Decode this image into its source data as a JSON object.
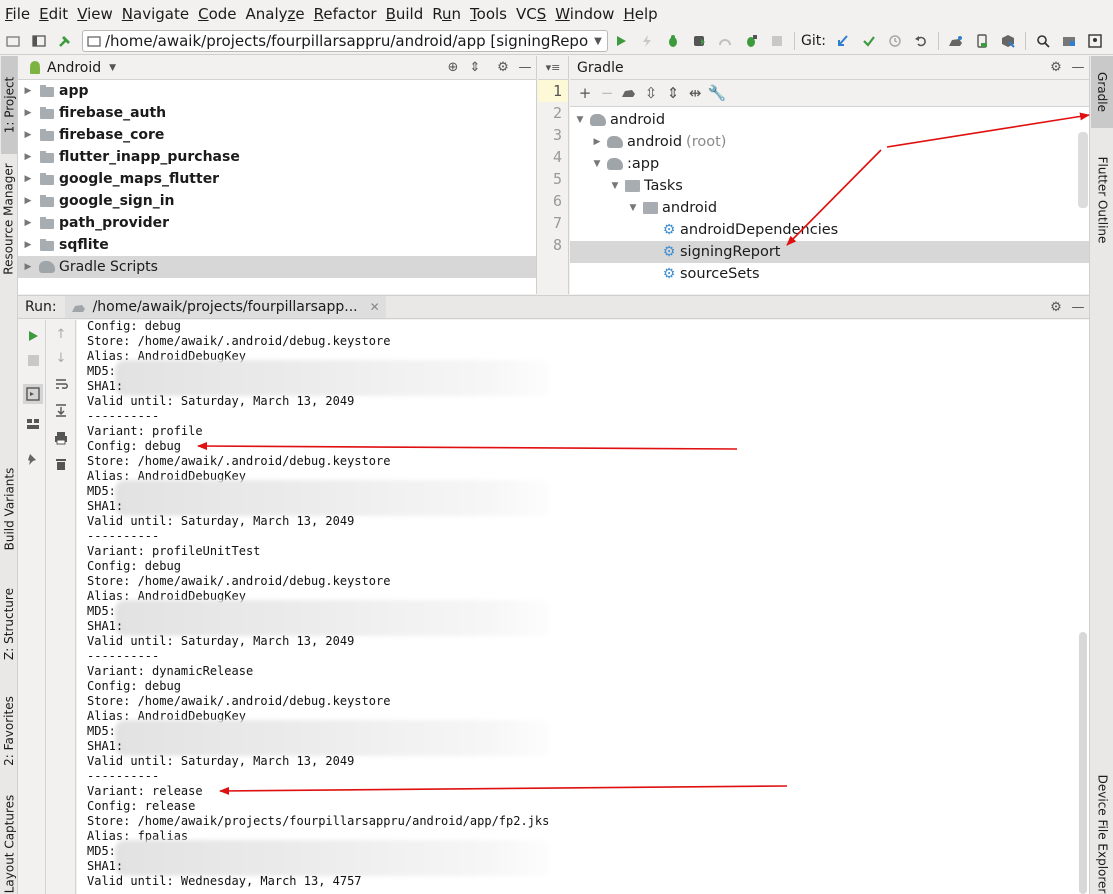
{
  "menu": [
    {
      "pre": "",
      "m": "F",
      "post": "ile"
    },
    {
      "pre": "",
      "m": "E",
      "post": "dit"
    },
    {
      "pre": "",
      "m": "V",
      "post": "iew"
    },
    {
      "pre": "",
      "m": "N",
      "post": "avigate"
    },
    {
      "pre": "",
      "m": "C",
      "post": "ode"
    },
    {
      "pre": "Analy",
      "m": "z",
      "post": "e"
    },
    {
      "pre": "",
      "m": "R",
      "post": "efactor"
    },
    {
      "pre": "",
      "m": "B",
      "post": "uild"
    },
    {
      "pre": "R",
      "m": "u",
      "post": "n"
    },
    {
      "pre": "",
      "m": "T",
      "post": "ools"
    },
    {
      "pre": "VC",
      "m": "S",
      "post": ""
    },
    {
      "pre": "",
      "m": "W",
      "post": "indow"
    },
    {
      "pre": "",
      "m": "H",
      "post": "elp"
    }
  ],
  "toolbar": {
    "run_config": "/home/awaik/projects/fourpillarsappru/android/app [signingReport]",
    "git_label": "Git:"
  },
  "left_strip": {
    "project": "1: Project",
    "resource_manager": "Resource Manager",
    "build_variants": "Build Variants",
    "structure": "Z: Structure",
    "favorites": "2: Favorites",
    "layout_captures": "Layout Captures"
  },
  "right_strip": {
    "gradle": "Gradle",
    "flutter_outline": "Flutter Outline",
    "device_file_explorer": "Device File Explorer"
  },
  "project": {
    "view_label": "Android",
    "items": [
      "app",
      "firebase_auth",
      "firebase_core",
      "flutter_inapp_purchase",
      "google_maps_flutter",
      "google_sign_in",
      "path_provider",
      "sqflite",
      "Gradle Scripts"
    ]
  },
  "gutter": {
    "lines": [
      "1",
      "2",
      "3",
      "4",
      "5",
      "6",
      "7",
      "8"
    ]
  },
  "gradle": {
    "title": "Gradle",
    "tree": {
      "root": "android",
      "android": "android",
      "android_root_suffix": "(root)",
      "app": ":app",
      "tasks": "Tasks",
      "tasks_android": "android",
      "task1": "androidDependencies",
      "task2": "signingReport",
      "task3": "sourceSets"
    }
  },
  "run": {
    "label": "Run:",
    "tab": "/home/awaik/projects/fourpillarsapp..."
  },
  "console": {
    "lines": [
      "Config: debug",
      "Store: /home/awaik/.android/debug.keystore",
      "Alias: AndroidDebugKey",
      "MD5:",
      "SHA1:",
      "Valid until: Saturday, March 13, 2049",
      "----------",
      "Variant: profile",
      "Config: debug",
      "Store: /home/awaik/.android/debug.keystore",
      "Alias: AndroidDebugKey",
      "MD5:",
      "SHA1:",
      "Valid until: Saturday, March 13, 2049",
      "----------",
      "Variant: profileUnitTest",
      "Config: debug",
      "Store: /home/awaik/.android/debug.keystore",
      "Alias: AndroidDebugKey",
      "MD5:",
      "SHA1:",
      "Valid until: Saturday, March 13, 2049",
      "----------",
      "Variant: dynamicRelease",
      "Config: debug",
      "Store: /home/awaik/.android/debug.keystore",
      "Alias: AndroidDebugKey",
      "MD5:",
      "SHA1:",
      "Valid until: Saturday, March 13, 2049",
      "----------",
      "Variant: release",
      "Config: release",
      "Store: /home/awaik/projects/fourpillarsappru/android/app/fp2.jks",
      "Alias: fpalias",
      "MD5:",
      "SHA1:",
      "Valid until: Wednesday, March 13, 4757"
    ]
  },
  "colors": {
    "annotation_arrow": "#e01010",
    "run_green": "#3c9b3c",
    "selection": "#d7d7d7",
    "gear_blue": "#3f8fd1"
  }
}
